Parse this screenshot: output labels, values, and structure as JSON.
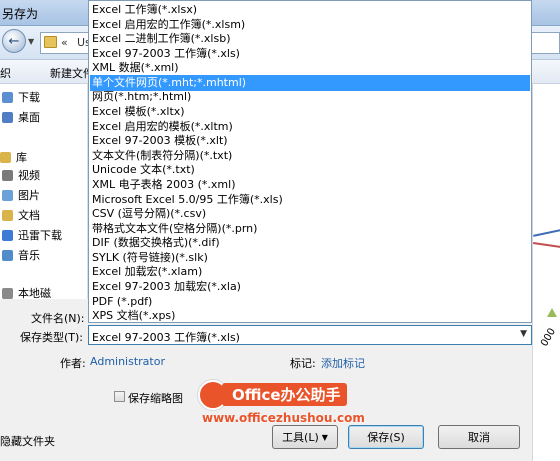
{
  "window": {
    "title": "另存为"
  },
  "address": {
    "separator": "«",
    "path_fragment": "Us"
  },
  "toolbar": {
    "organize_label": "织",
    "new_folder_label": "新建文件夹"
  },
  "navigation": {
    "items": [
      {
        "label": "下载",
        "icon": "download-folder-icon",
        "color": "#5b8fd1"
      },
      {
        "label": "桌面",
        "icon": "desktop-icon",
        "color": "#4f7ec4"
      },
      {
        "label": "库",
        "icon": "library-icon",
        "color": "#d9b44a"
      },
      {
        "label": "视频",
        "icon": "video-icon",
        "color": "#7a7a7a"
      },
      {
        "label": "图片",
        "icon": "pictures-icon",
        "color": "#6aa1d8"
      },
      {
        "label": "文档",
        "icon": "documents-icon",
        "color": "#d9b44a"
      },
      {
        "label": "迅雷下载",
        "icon": "thunder-download-icon",
        "color": "#3e7bd6"
      },
      {
        "label": "音乐",
        "icon": "music-icon",
        "color": "#4f8cc9"
      },
      {
        "label": "本地磁",
        "icon": "local-disk-icon",
        "color": "#8a8a8a"
      }
    ]
  },
  "file_types": {
    "selected_index": 5,
    "options": [
      "Excel 工作簿(*.xlsx)",
      "Excel 启用宏的工作簿(*.xlsm)",
      "Excel 二进制工作簿(*.xlsb)",
      "Excel 97-2003 工作簿(*.xls)",
      "XML 数据(*.xml)",
      "单个文件网页(*.mht;*.mhtml)",
      "网页(*.htm;*.html)",
      "Excel 模板(*.xltx)",
      "Excel 启用宏的模板(*.xltm)",
      "Excel 97-2003 模板(*.xlt)",
      "文本文件(制表符分隔)(*.txt)",
      "Unicode 文本(*.txt)",
      "XML 电子表格 2003 (*.xml)",
      "Microsoft Excel 5.0/95 工作簿(*.xls)",
      "CSV (逗号分隔)(*.csv)",
      "带格式文本文件(空格分隔)(*.prn)",
      "DIF (数据交换格式)(*.dif)",
      "SYLK (符号链接)(*.slk)",
      "Excel 加载宏(*.xlam)",
      "Excel 97-2003 加载宏(*.xla)",
      "PDF (*.pdf)",
      "XPS 文档(*.xps)"
    ]
  },
  "fields": {
    "filename_label": "文件名(N):",
    "savetype_label": "保存类型(T):",
    "savetype_value": "Excel 97-2003 工作簿(*.xls)",
    "author_label": "作者:",
    "author_value": "Administrator",
    "tags_label": "标记:",
    "tags_value": "添加标记",
    "thumbnail_label": "保存缩略图"
  },
  "footer": {
    "hide_folders_label": "隐藏文件夹",
    "tools_label": "工具(L)",
    "save_label": "保存(S)",
    "cancel_label": "取消"
  },
  "watermark": {
    "brand": "Office办公助手",
    "url": "www.officezhushou.com"
  },
  "background_chart": {
    "tick_fragment": "000"
  }
}
